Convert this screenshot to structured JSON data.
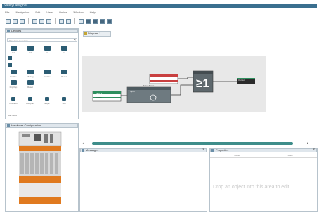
{
  "window": {
    "title": "SafetyDesigner",
    "menu": [
      "File",
      "Navigation",
      "Edit",
      "View",
      "Online",
      "Window",
      "Help"
    ]
  },
  "devices_panel": {
    "title": "Devices",
    "filter_placeholder": "Type here to search...",
    "items": [
      {
        "label": "In1",
        "icon": "input-block-icon"
      },
      {
        "label": "In2",
        "icon": "input-block-icon"
      },
      {
        "label": "In3",
        "icon": "input-block-icon"
      },
      {
        "label": "In4",
        "icon": "input-block-icon"
      },
      {
        "label": "Enable",
        "icon": "logic-block-icon"
      },
      {
        "label": "Muting",
        "icon": "logic-block-icon"
      },
      {
        "label": "Enable",
        "icon": "logic-block-icon"
      },
      {
        "label": "Reset",
        "icon": "logic-block-icon"
      },
      {
        "label": "FlipFlop",
        "icon": "logic-block-icon"
      },
      {
        "label": "Reset",
        "icon": "logic-block-icon"
      },
      {
        "label": "Operator",
        "icon": "operator-icon"
      },
      {
        "label": "Compare",
        "icon": "compare-icon"
      },
      {
        "label": "Edge",
        "icon": "edge-icon"
      },
      {
        "label": "Sub",
        "icon": "sub-icon"
      }
    ],
    "more_label": "Add More"
  },
  "hw_panel": {
    "title": "Hardware Configuration"
  },
  "editor": {
    "tab_label": "Diagram 1",
    "blocks": {
      "input1_label": "Input 1",
      "input1_sub": "Enable",
      "reset_title": "Reset Timer",
      "reset_sub": "Input",
      "and_symbol": "≥1",
      "output_label": "Output"
    }
  },
  "messages_panel": {
    "title": "Messages"
  },
  "properties_panel": {
    "title": "Properties",
    "columns": [
      "Name",
      "Value"
    ],
    "drop_hint": "Drop an object into this area to edit"
  }
}
